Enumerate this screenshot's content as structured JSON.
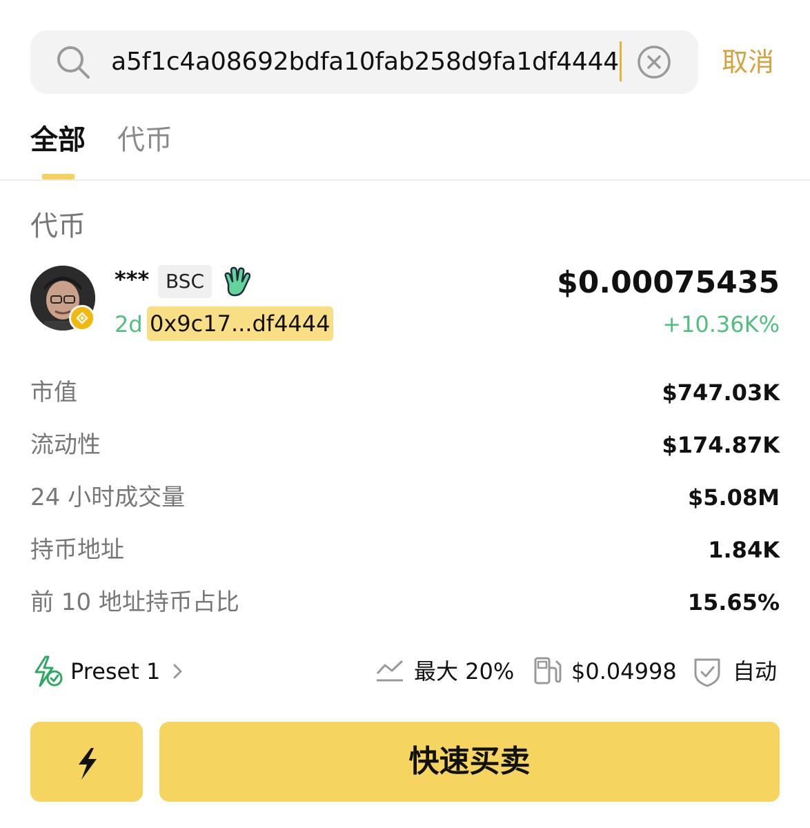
{
  "search": {
    "query": "a5f1c4a08692bdfa10fab258d9fa1df4444",
    "cancel_label": "取消"
  },
  "tabs": [
    {
      "label": "全部"
    },
    {
      "label": "代币"
    }
  ],
  "section_title": "代币",
  "token": {
    "name": "***",
    "chain": "BSC",
    "age": "2d",
    "address": "0x9c17...df4444",
    "price": "$0.00075435",
    "change": "+10.36K%"
  },
  "stats": [
    {
      "label": "市值",
      "value": "$747.03K"
    },
    {
      "label": "流动性",
      "value": "$174.87K"
    },
    {
      "label": "24 小时成交量",
      "value": "$5.08M"
    },
    {
      "label": "持币地址",
      "value": "1.84K"
    },
    {
      "label": "前 10 地址持币占比",
      "value": "15.65%"
    }
  ],
  "settings": {
    "preset": "Preset 1",
    "slippage": "最大 20%",
    "gas": "$0.04998",
    "mode": "自动"
  },
  "buttons": {
    "quick_trade": "快速买卖"
  },
  "colors": {
    "accent": "#f5d560",
    "positive": "#4fbf80",
    "cancel": "#d4a23f"
  }
}
